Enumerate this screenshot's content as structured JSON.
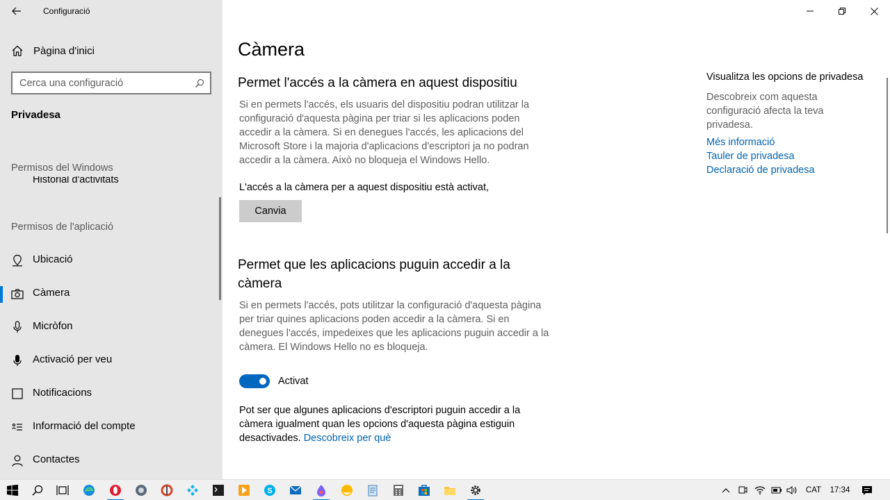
{
  "window": {
    "app_title": "Configuració"
  },
  "sidebar": {
    "home_label": "Pàgina d'inici",
    "search_placeholder": "Cerca una configuració",
    "section_title": "Privadesa",
    "windows_permissions_label": "Permisos del Windows",
    "partial_item_label": "Historial d'activitats",
    "app_permissions_label": "Permisos de l'aplicació",
    "items": [
      {
        "label": "Ubicació",
        "icon": "location-icon"
      },
      {
        "label": "Càmera",
        "icon": "camera-icon",
        "selected": true
      },
      {
        "label": "Micròfon",
        "icon": "microphone-icon"
      },
      {
        "label": "Activació per veu",
        "icon": "voice-activation-icon"
      },
      {
        "label": "Notificacions",
        "icon": "notifications-icon"
      },
      {
        "label": "Informació del compte",
        "icon": "account-info-icon"
      },
      {
        "label": "Contactes",
        "icon": "contacts-icon"
      }
    ]
  },
  "main": {
    "title": "Càmera",
    "device_section": {
      "heading": "Permet l'accés a la càmera en aquest dispositiu",
      "description": "Si en permets l'accés, els usuaris del dispositiu podran utilitzar la configuració d'aquesta pàgina per triar si les aplicacions poden accedir a la càmera. Si en denegues l'accés, les aplicacions del Microsoft Store i la majoria d'aplicacions d'escriptori ja no podran accedir a la càmera. Això no bloqueja el Windows Hello.",
      "status": "L'accés a la càmera per a aquest dispositiu està activat,",
      "button_label": "Canvia"
    },
    "apps_section": {
      "heading": "Permet que les aplicacions puguin accedir a la càmera",
      "description": "Si en permets l'accés, pots utilitzar la configuració d'aquesta pàgina per triar quines aplicacions poden accedir a la càmera. Si en denegues l'accés, impedeixes que les aplicacions puguin accedir a la càmera. El Windows Hello no es bloqueja.",
      "toggle_state": "Activat",
      "toggle_on": true,
      "note": "Pot ser que algunes aplicacions d'escriptori puguin accedir a la càmera igualment quan les opcions d'aquesta pàgina estiguin desactivades.",
      "note_link": "Descobreix per què"
    }
  },
  "right_column": {
    "title": "Visualitza les opcions de privadesa",
    "description": "Descobreix com aquesta configuració afecta la teva privadesa.",
    "links": [
      "Més informació",
      "Tauler de privadesa",
      "Declaració de privadesa"
    ]
  },
  "taskbar": {
    "apps": [
      "start-icon",
      "search-icon",
      "task-view-icon",
      "edge-icon",
      "opera-icon",
      "steam-icon",
      "ccleaner-icon",
      "kodi-icon",
      "terminal-icon",
      "media-player-icon",
      "skype-icon",
      "mail-icon",
      "paint-icon",
      "photos-icon",
      "notepad-icon",
      "calculator-icon",
      "store-icon",
      "file-explorer-icon",
      "settings-icon"
    ],
    "language": "CAT",
    "time": "17:34"
  },
  "colors": {
    "accent": "#0078d7",
    "link": "#0063b1",
    "sidebar_bg": "#e6e6e6",
    "toggle_on": "#0067c0"
  }
}
